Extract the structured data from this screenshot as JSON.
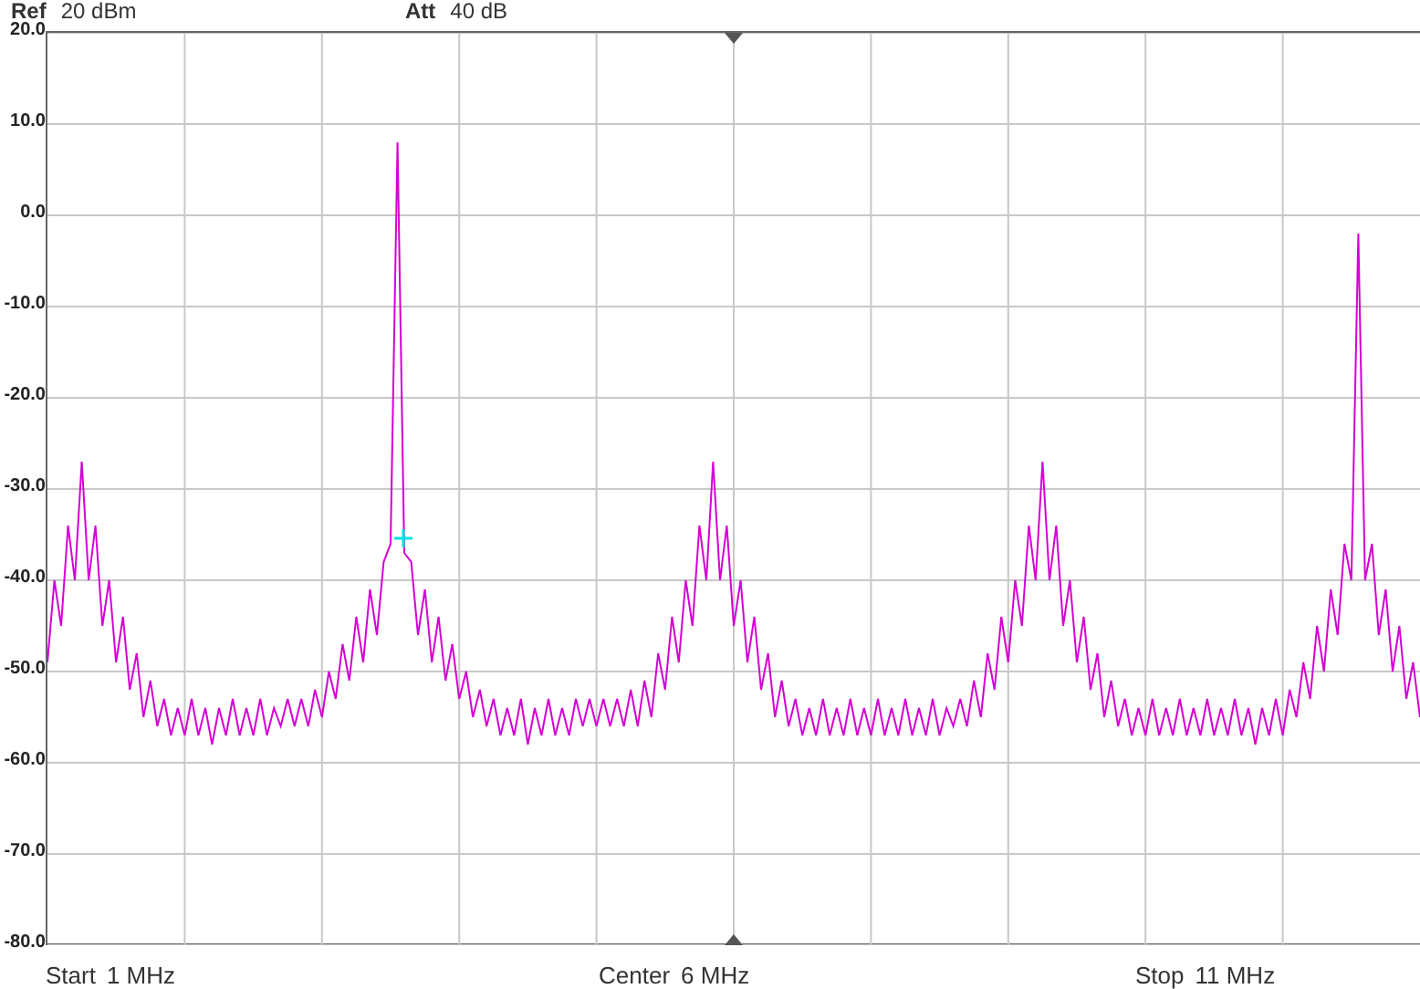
{
  "header": [
    {
      "label": "Ref",
      "value": "20 dBm"
    },
    {
      "label": "Att",
      "value": "40 dB"
    }
  ],
  "chart_data": {
    "type": "line",
    "grid": true,
    "ylim": [
      -80,
      20
    ],
    "yticks": [
      {
        "value": 20,
        "label": "20.0"
      },
      {
        "value": 10,
        "label": "10.0"
      },
      {
        "value": 0,
        "label": "0.0"
      },
      {
        "value": -10,
        "label": "-10.0"
      },
      {
        "value": -20,
        "label": "-20.0"
      },
      {
        "value": -30,
        "label": "-30.0"
      },
      {
        "value": -40,
        "label": "-40.0"
      },
      {
        "value": -50,
        "label": "-50.0"
      },
      {
        "value": -60,
        "label": "-60.0"
      },
      {
        "value": -70,
        "label": "-70.0"
      },
      {
        "value": -80,
        "label": "-80.0"
      }
    ],
    "series": [
      {
        "color": "#d400d4",
        "values": [
          -49,
          -40,
          -45,
          -34,
          -40,
          -27,
          -40,
          -34,
          -45,
          -40,
          -49,
          -44,
          -52,
          -48,
          -55,
          -51,
          -56,
          -53,
          -57,
          -54,
          -57,
          -53,
          -57,
          -54,
          -58,
          -54,
          -57,
          -53,
          -57,
          -54,
          -57,
          -53,
          -57,
          -54,
          -56,
          -53,
          -56,
          -53,
          -56,
          -52,
          -55,
          -50,
          -53,
          -47,
          -51,
          -44,
          -49,
          -41,
          -46,
          -38,
          -36,
          8,
          -37,
          -38,
          -46,
          -41,
          -49,
          -44,
          -51,
          -47,
          -53,
          -50,
          -55,
          -52,
          -56,
          -53,
          -57,
          -54,
          -57,
          -53,
          -58,
          -54,
          -57,
          -53,
          -57,
          -54,
          -57,
          -53,
          -56,
          -53,
          -56,
          -53,
          -56,
          -53,
          -56,
          -52,
          -56,
          -51,
          -55,
          -48,
          -52,
          -44,
          -49,
          -40,
          -45,
          -34,
          -40,
          -27,
          -40,
          -34,
          -45,
          -40,
          -49,
          -44,
          -52,
          -48,
          -55,
          -51,
          -56,
          -53,
          -57,
          -54,
          -57,
          -53,
          -57,
          -54,
          -57,
          -53,
          -57,
          -54,
          -57,
          -53,
          -57,
          -54,
          -57,
          -53,
          -57,
          -54,
          -57,
          -53,
          -57,
          -54,
          -56,
          -53,
          -56,
          -51,
          -55,
          -48,
          -52,
          -44,
          -49,
          -40,
          -45,
          -34,
          -40,
          -27,
          -40,
          -34,
          -45,
          -40,
          -49,
          -44,
          -52,
          -48,
          -55,
          -51,
          -56,
          -53,
          -57,
          -54,
          -57,
          -53,
          -57,
          -54,
          -57,
          -53,
          -57,
          -54,
          -57,
          -53,
          -57,
          -54,
          -57,
          -53,
          -57,
          -54,
          -58,
          -54,
          -57,
          -53,
          -57,
          -52,
          -55,
          -49,
          -53,
          -45,
          -50,
          -41,
          -46,
          -36,
          -40,
          -2,
          -40,
          -36,
          -46,
          -41,
          -50,
          -45,
          -53,
          -49,
          -55
        ]
      }
    ]
  },
  "footer": [
    {
      "label": "Start",
      "value": "1 MHz"
    },
    {
      "label": "Center",
      "value": "6 MHz"
    },
    {
      "label": "Stop",
      "value": "11 MHz"
    }
  ]
}
